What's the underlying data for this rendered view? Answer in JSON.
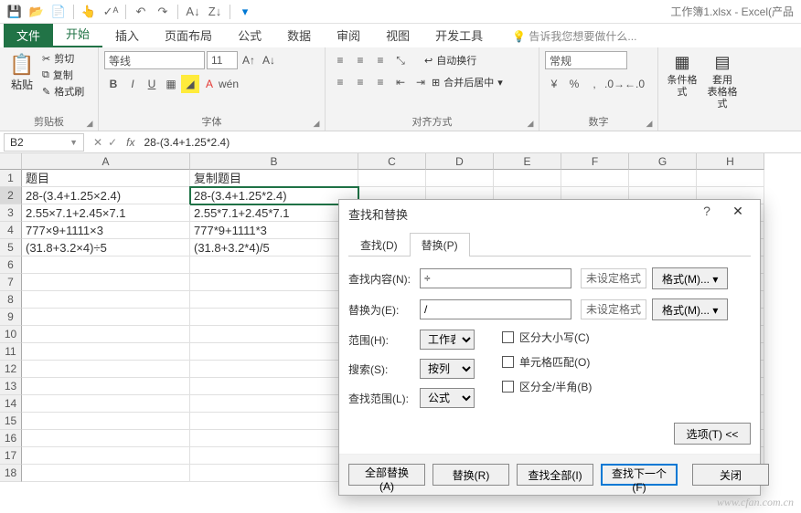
{
  "app_title": "工作簿1.xlsx - Excel(产品",
  "tabs": {
    "file": "文件",
    "home": "开始",
    "insert": "插入",
    "page_layout": "页面布局",
    "formulas": "公式",
    "data": "数据",
    "review": "审阅",
    "view": "视图",
    "developer": "开发工具",
    "tellme": "告诉我您想要做什么..."
  },
  "ribbon": {
    "clipboard": {
      "title": "剪贴板",
      "paste": "粘贴",
      "cut": "剪切",
      "copy": "复制",
      "painter": "格式刷"
    },
    "font": {
      "title": "字体",
      "name": "等线",
      "size": "11",
      "pinyin": "wén"
    },
    "align": {
      "title": "对齐方式",
      "wrap": "自动换行",
      "merge": "合并后居中"
    },
    "number": {
      "title": "数字",
      "format": "常规"
    },
    "styles": {
      "cond": "条件格式",
      "table": "套用\n表格格式"
    }
  },
  "formula_bar": {
    "cell_ref": "B2",
    "formula": "28-(3.4+1.25*2.4)"
  },
  "columns": [
    "A",
    "B",
    "C",
    "D",
    "E",
    "F",
    "G",
    "H"
  ],
  "rows": [
    {
      "n": "1",
      "a": "题目",
      "b": "复制题目"
    },
    {
      "n": "2",
      "a": "28-(3.4+1.25×2.4)",
      "b": "28-(3.4+1.25*2.4)"
    },
    {
      "n": "3",
      "a": "2.55×7.1+2.45×7.1",
      "b": "2.55*7.1+2.45*7.1"
    },
    {
      "n": "4",
      "a": "777×9+1111×3",
      "b": "777*9+1111*3"
    },
    {
      "n": "5",
      "a": "(31.8+3.2×4)÷5",
      "b": "(31.8+3.2*4)/5"
    },
    {
      "n": "6",
      "a": "",
      "b": ""
    },
    {
      "n": "7",
      "a": "",
      "b": ""
    },
    {
      "n": "8",
      "a": "",
      "b": ""
    },
    {
      "n": "9",
      "a": "",
      "b": ""
    },
    {
      "n": "10",
      "a": "",
      "b": ""
    },
    {
      "n": "11",
      "a": "",
      "b": ""
    },
    {
      "n": "12",
      "a": "",
      "b": ""
    },
    {
      "n": "13",
      "a": "",
      "b": ""
    },
    {
      "n": "14",
      "a": "",
      "b": ""
    },
    {
      "n": "15",
      "a": "",
      "b": ""
    },
    {
      "n": "16",
      "a": "",
      "b": ""
    },
    {
      "n": "17",
      "a": "",
      "b": ""
    },
    {
      "n": "18",
      "a": "",
      "b": ""
    }
  ],
  "dialog": {
    "title": "查找和替换",
    "tab_find": "查找(D)",
    "tab_replace": "替换(P)",
    "find_label": "查找内容(N):",
    "find_value": "÷",
    "replace_label": "替换为(E):",
    "replace_value": "/",
    "no_format": "未设定格式",
    "format_btn": "格式(M)...",
    "scope_label": "范围(H):",
    "scope_value": "工作表",
    "search_label": "搜索(S):",
    "search_value": "按列",
    "lookin_label": "查找范围(L):",
    "lookin_value": "公式",
    "match_case": "区分大小写(C)",
    "match_cell": "单元格匹配(O)",
    "match_width": "区分全/半角(B)",
    "options_btn": "选项(T) <<",
    "replace_all": "全部替换(A)",
    "replace_btn": "替换(R)",
    "find_all": "查找全部(I)",
    "find_next": "查找下一个(F)",
    "close": "关闭"
  },
  "watermark": "www.cfan.com.cn"
}
